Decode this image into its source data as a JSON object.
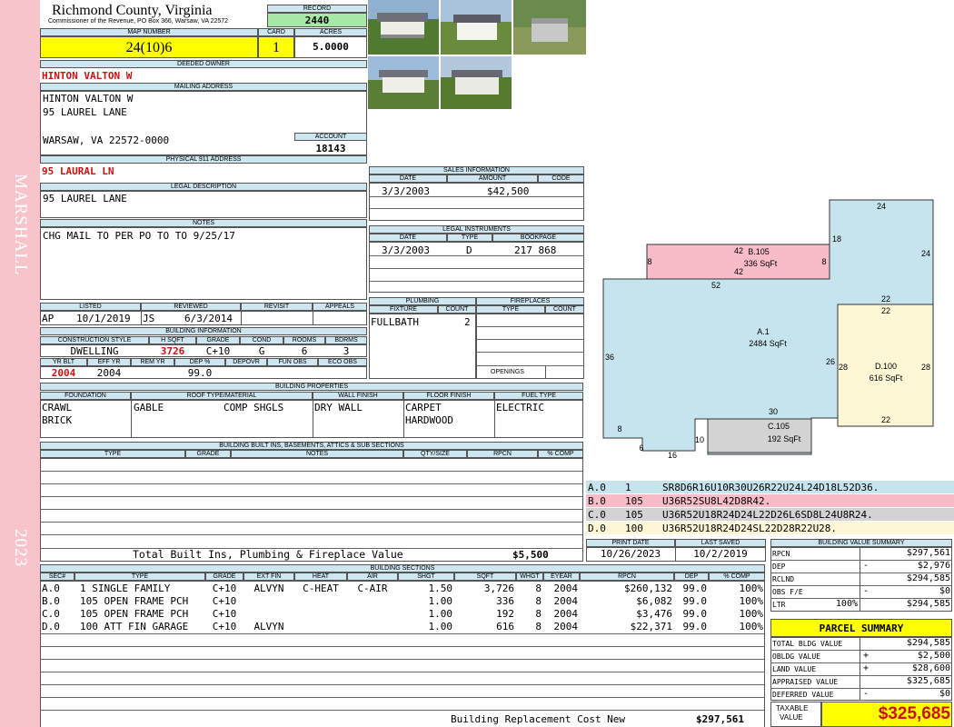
{
  "side": {
    "owner_vert": "MARSHALL",
    "year_vert": "2023"
  },
  "header": {
    "county": "Richmond County, Virginia",
    "commissioner": "Commissioner of the Revenue, PO Box 366, Warsaw, VA 22572",
    "record_label": "RECORD",
    "record": "2440",
    "map_label": "MAP NUMBER",
    "map_number": "24(10)6",
    "card_label": "CARD",
    "card": "1",
    "acres_label": "ACRES",
    "acres": "5.0000"
  },
  "owner": {
    "deeded_label": "DEEDED OWNER",
    "deeded": "HINTON VALTON W",
    "mailing_label": "MAILING ADDRESS",
    "mail1": "HINTON VALTON W",
    "mail2": "95 LAUREL LANE",
    "mail3": "WARSAW, VA 22572-0000",
    "account_label": "ACCOUNT",
    "account": "18143",
    "physical_label": "PHYSICAL 911 ADDRESS",
    "physical": "95 LAURAL LN",
    "legal_label": "LEGAL DESCRIPTION",
    "legal": "95 LAUREL LANE",
    "notes_label": "NOTES",
    "notes": "CHG MAIL TO PER PO TO TO 9/25/17"
  },
  "review": {
    "listed_label": "LISTED",
    "listed_by": "AP",
    "listed_date": "10/1/2019",
    "reviewed_label": "REVIEWED",
    "reviewed_by": "JS",
    "reviewed_date": "6/3/2014",
    "revisit_label": "REVISIT",
    "appeals_label": "APPEALS"
  },
  "building": {
    "title": "BUILDING INFORMATION",
    "cs_label": "CONSTRUCTION STYLE",
    "hsqft_label": "H SQFT",
    "grade_label": "GRADE",
    "cond_label": "COND",
    "rooms_label": "ROOMS",
    "bdrms_label": "BDRMS",
    "cs": "DWELLING",
    "hsqft": "3726",
    "grade": "C+10",
    "cond": "G",
    "rooms": "6",
    "bdrms": "3",
    "yrblt_label": "YR BLT",
    "effyr_label": "EFF YR",
    "remyr_label": "REM YR",
    "dep_label": "DEP %",
    "depovr_label": "DEPOVR",
    "funobs_label": "FUN OBS",
    "ecoobs_label": "ECO OBS",
    "yrblt": "2004",
    "effyr": "2004",
    "dep": "99.0"
  },
  "sales": {
    "title": "SALES INFORMATION",
    "date_label": "DATE",
    "amount_label": "AMOUNT",
    "code_label": "CODE",
    "date": "3/3/2003",
    "amount": "$42,500"
  },
  "legal_inst": {
    "title": "LEGAL INSTRUMENTS",
    "date_label": "DATE",
    "type_label": "TYPE",
    "book_label": "BOOKPAGE",
    "date": "3/3/2003",
    "type": "D",
    "book": "217 868"
  },
  "plumbing": {
    "title": "PLUMBING",
    "fixture_label": "FIXTURE",
    "count_label": "COUNT",
    "fixture": "FULLBATH",
    "count": "2"
  },
  "fireplaces": {
    "title": "FIREPLACES",
    "type_label": "TYPE",
    "count_label": "COUNT",
    "openings_label": "OPENINGS"
  },
  "properties": {
    "title": "BUILDING PROPERTIES",
    "foundation_label": "FOUNDATION",
    "roof_label": "ROOF TYPE/MATERIAL",
    "wall_label": "WALL FINISH",
    "floor_label": "FLOOR FINISH",
    "fuel_label": "FUEL TYPE",
    "foundation1": "CRAWL",
    "foundation2": "BRICK",
    "roof_type": "GABLE",
    "roof_mat": "COMP SHGLS",
    "wall": "DRY WALL",
    "floor1": "CARPET",
    "floor2": "HARDWOOD",
    "fuel": "ELECTRIC"
  },
  "builtins": {
    "title": "BUILDING BUILT INS, BASEMENTS, ATTICS & SUB SECTIONS",
    "type_label": "TYPE",
    "grade_label": "GRADE",
    "notes_label": "NOTES",
    "qty_label": "QTY/SIZE",
    "rpcn_label": "RPCN",
    "comp_label": "% COMP",
    "total_label": "Total Built Ins, Plumbing & Fireplace Value",
    "total": "$5,500"
  },
  "print": {
    "print_label": "PRINT DATE",
    "saved_label": "LAST SAVED",
    "print": "10/26/2023",
    "saved": "10/2/2019"
  },
  "sections": {
    "title": "BUILDING SECTIONS",
    "headers": [
      "SEC#",
      "TYPE",
      "GRADE",
      "EXT FIN",
      "HEAT",
      "AIR",
      "SHGT",
      "SQFT",
      "WHGT",
      "EYEAR",
      "RPCN",
      "DEP",
      "% COMP"
    ],
    "rows": [
      [
        "A.0",
        "1 SINGLE FAMILY",
        "C+10",
        "ALVYN",
        "C-HEAT",
        "C-AIR",
        "1.50",
        "3,726",
        "8",
        "2004",
        "$260,132",
        "99.0",
        "100%"
      ],
      [
        "B.0",
        "105 OPEN FRAME PCH",
        "C+10",
        "",
        "",
        "",
        "1.00",
        "336",
        "8",
        "2004",
        "$6,082",
        "99.0",
        "100%"
      ],
      [
        "C.0",
        "105 OPEN FRAME PCH",
        "C+10",
        "",
        "",
        "",
        "1.00",
        "192",
        "8",
        "2004",
        "$3,476",
        "99.0",
        "100%"
      ],
      [
        "D.0",
        "100 ATT FIN GARAGE",
        "C+10",
        "ALVYN",
        "",
        "",
        "1.00",
        "616",
        "8",
        "2004",
        "$22,371",
        "99.0",
        "100%"
      ]
    ],
    "total_label": "Building Replacement Cost New",
    "total": "$297,561"
  },
  "sketch": {
    "a_label": "A.1",
    "a_area": "2484 SqFt",
    "b_label": "B.105",
    "b_area": "336 SqFt",
    "c_label": "C.105",
    "c_area": "192 SqFt",
    "d_label": "D.100",
    "d_area": "616 SqFt",
    "dims": [
      "24",
      "18",
      "24",
      "42",
      "8",
      "8",
      "42",
      "52",
      "22",
      "22",
      "36",
      "26",
      "28",
      "28",
      "30",
      "22",
      "8",
      "6",
      "16",
      "10"
    ],
    "color_a": "#c6e4ee",
    "color_b": "#f7bcc8",
    "color_c": "#d3d3d3",
    "color_d": "#fdf7d6"
  },
  "codes": [
    {
      "sec": "A.0",
      "num": "1",
      "code": "SR8D6R16U10R30U26R22U24L24D18L52D36.",
      "color": "#c6e4ee"
    },
    {
      "sec": "B.0",
      "num": "105",
      "code": "U36R52SU8L42D8R42.",
      "color": "#f7bcc8"
    },
    {
      "sec": "C.0",
      "num": "105",
      "code": "U36R52U18R24D24L22D26L6SD8L24U8R24.",
      "color": "#d3d3d3"
    },
    {
      "sec": "D.0",
      "num": "100",
      "code": "U36R52U18R24D24SL22D28R22U28.",
      "color": "#fdf7d6"
    }
  ],
  "value_summary": {
    "title": "BUILDING VALUE SUMMARY",
    "rpcn_label": "RPCN",
    "rpcn": "$297,561",
    "dep_label": "DEP",
    "dep_sign": "-",
    "dep": "$2,976",
    "rclnd_label": "RCLND",
    "rclnd": "$294,585",
    "obs_label": "OBS F/E",
    "obs_sign": "-",
    "obs": "$0",
    "ltr_label": "LTR",
    "ltr_pct": "100%",
    "ltr": "$294,585"
  },
  "parcel": {
    "title": "PARCEL SUMMARY",
    "bldg_label": "TOTAL BLDG VALUE",
    "bldg": "$294,585",
    "obldg_label": "OBLDG VALUE",
    "obldg_sign": "+",
    "obldg": "$2,500",
    "land_label": "LAND VALUE",
    "land_sign": "+",
    "land": "$28,600",
    "appraised_label": "APPRAISED VALUE",
    "appraised": "$325,685",
    "deferred_label": "DEFERRED VALUE",
    "deferred_sign": "-",
    "deferred": "$0",
    "taxable_label1": "TAXABLE",
    "taxable_label2": "VALUE",
    "taxable": "$325,685"
  }
}
